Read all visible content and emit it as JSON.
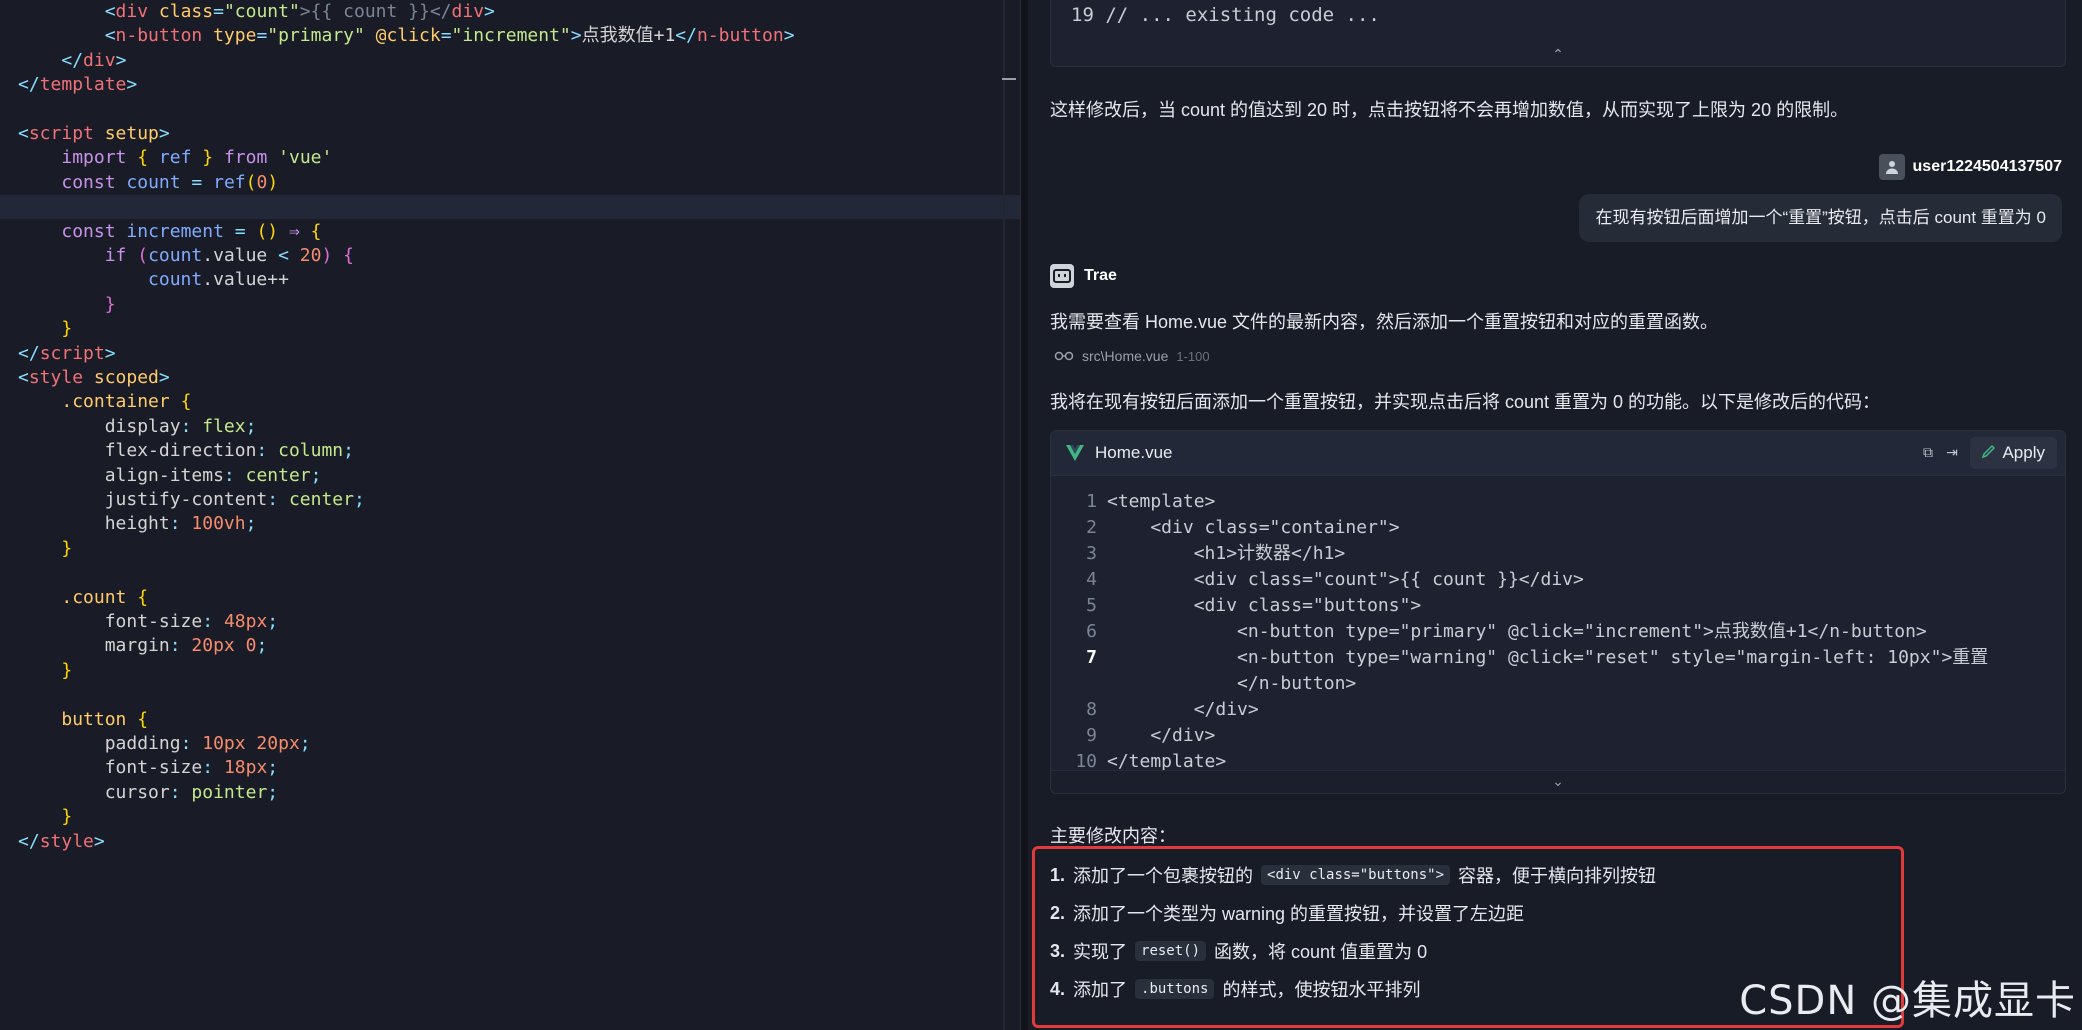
{
  "editor": {
    "lines": [
      [
        [
          "        ",
          "tok-text"
        ],
        [
          "<",
          "tok-punc"
        ],
        [
          "div ",
          "tok-tag"
        ],
        [
          "class",
          "tok-attr"
        ],
        [
          "=",
          "tok-punc"
        ],
        [
          "\"count\"",
          "tok-str"
        ],
        [
          ">{{ count }}</",
          "tok-cmt"
        ],
        [
          "div",
          "tok-tag"
        ],
        [
          ">",
          "tok-punc"
        ]
      ],
      [
        [
          "        ",
          "tok-text"
        ],
        [
          "<",
          "tok-punc"
        ],
        [
          "n-button ",
          "tok-tag"
        ],
        [
          "type",
          "tok-attr"
        ],
        [
          "=",
          "tok-punc"
        ],
        [
          "\"primary\" ",
          "tok-str"
        ],
        [
          "@click",
          "tok-attr"
        ],
        [
          "=",
          "tok-punc"
        ],
        [
          "\"increment\"",
          "tok-str"
        ],
        [
          ">",
          "tok-punc"
        ],
        [
          "点我数值+1",
          "tok-text"
        ],
        [
          "</",
          "tok-punc"
        ],
        [
          "n-button",
          "tok-tag"
        ],
        [
          ">",
          "tok-punc"
        ]
      ],
      [
        [
          "    ",
          "tok-text"
        ],
        [
          "</",
          "tok-punc"
        ],
        [
          "div",
          "tok-tag"
        ],
        [
          ">",
          "tok-punc"
        ]
      ],
      [
        [
          "</",
          "tok-punc"
        ],
        [
          "template",
          "tok-tag"
        ],
        [
          ">",
          "tok-punc"
        ]
      ],
      [
        [
          "",
          "tok-text"
        ]
      ],
      [
        [
          "<",
          "tok-punc"
        ],
        [
          "script ",
          "tok-tag"
        ],
        [
          "setup",
          "tok-attr"
        ],
        [
          ">",
          "tok-punc"
        ]
      ],
      [
        [
          "    ",
          "tok-text"
        ],
        [
          "import ",
          "tok-kw"
        ],
        [
          "{ ",
          "tok-brace"
        ],
        [
          "ref ",
          "tok-var"
        ],
        [
          "} ",
          "tok-brace"
        ],
        [
          "from ",
          "tok-kw"
        ],
        [
          "'vue'",
          "tok-str"
        ]
      ],
      [
        [
          "    ",
          "tok-text"
        ],
        [
          "const ",
          "tok-kw"
        ],
        [
          "count ",
          "tok-var"
        ],
        [
          "= ",
          "tok-punc"
        ],
        [
          "ref",
          "tok-var"
        ],
        [
          "(",
          "tok-brace"
        ],
        [
          "0",
          "tok-num"
        ],
        [
          ")",
          "tok-brace"
        ]
      ],
      [
        [
          "",
          "tok-text"
        ]
      ],
      [
        [
          "    ",
          "tok-text"
        ],
        [
          "const ",
          "tok-kw"
        ],
        [
          "increment ",
          "tok-var"
        ],
        [
          "= ",
          "tok-punc"
        ],
        [
          "() ",
          "tok-brace"
        ],
        [
          "⇒ ",
          "tok-kw"
        ],
        [
          "{",
          "tok-brace"
        ]
      ],
      [
        [
          "        ",
          "tok-text"
        ],
        [
          "if ",
          "tok-kw"
        ],
        [
          "(",
          "tok-brace2"
        ],
        [
          "count",
          "tok-var"
        ],
        [
          ".value ",
          "tok-prop"
        ],
        [
          "< ",
          "tok-punc"
        ],
        [
          "20",
          "tok-num"
        ],
        [
          ") {",
          "tok-brace2"
        ]
      ],
      [
        [
          "            ",
          "tok-text"
        ],
        [
          "count",
          "tok-var"
        ],
        [
          ".value++",
          "tok-prop"
        ]
      ],
      [
        [
          "        ",
          "tok-text"
        ],
        [
          "}",
          "tok-brace2"
        ]
      ],
      [
        [
          "    ",
          "tok-text"
        ],
        [
          "}",
          "tok-brace"
        ]
      ],
      [
        [
          "</",
          "tok-punc"
        ],
        [
          "script",
          "tok-tag"
        ],
        [
          ">",
          "tok-punc"
        ]
      ],
      [
        [
          "<",
          "tok-punc"
        ],
        [
          "style ",
          "tok-tag"
        ],
        [
          "scoped",
          "tok-attr"
        ],
        [
          ">",
          "tok-punc"
        ]
      ],
      [
        [
          "    ",
          "tok-text"
        ],
        [
          ".container ",
          "tok-attr"
        ],
        [
          "{",
          "tok-brace"
        ]
      ],
      [
        [
          "        ",
          "tok-text"
        ],
        [
          "display",
          "tok-prop"
        ],
        [
          ": ",
          "tok-punc"
        ],
        [
          "flex",
          "tok-val"
        ],
        [
          ";",
          "tok-punc"
        ]
      ],
      [
        [
          "        ",
          "tok-text"
        ],
        [
          "flex-direction",
          "tok-prop"
        ],
        [
          ": ",
          "tok-punc"
        ],
        [
          "column",
          "tok-val"
        ],
        [
          ";",
          "tok-punc"
        ]
      ],
      [
        [
          "        ",
          "tok-text"
        ],
        [
          "align-items",
          "tok-prop"
        ],
        [
          ": ",
          "tok-punc"
        ],
        [
          "center",
          "tok-val"
        ],
        [
          ";",
          "tok-punc"
        ]
      ],
      [
        [
          "        ",
          "tok-text"
        ],
        [
          "justify-content",
          "tok-prop"
        ],
        [
          ": ",
          "tok-punc"
        ],
        [
          "center",
          "tok-val"
        ],
        [
          ";",
          "tok-punc"
        ]
      ],
      [
        [
          "        ",
          "tok-text"
        ],
        [
          "height",
          "tok-prop"
        ],
        [
          ": ",
          "tok-punc"
        ],
        [
          "100vh",
          "tok-num"
        ],
        [
          ";",
          "tok-punc"
        ]
      ],
      [
        [
          "    ",
          "tok-text"
        ],
        [
          "}",
          "tok-brace"
        ]
      ],
      [
        [
          "",
          "tok-text"
        ]
      ],
      [
        [
          "    ",
          "tok-text"
        ],
        [
          ".count ",
          "tok-attr"
        ],
        [
          "{",
          "tok-brace"
        ]
      ],
      [
        [
          "        ",
          "tok-text"
        ],
        [
          "font-size",
          "tok-prop"
        ],
        [
          ": ",
          "tok-punc"
        ],
        [
          "48px",
          "tok-num"
        ],
        [
          ";",
          "tok-punc"
        ]
      ],
      [
        [
          "        ",
          "tok-text"
        ],
        [
          "margin",
          "tok-prop"
        ],
        [
          ": ",
          "tok-punc"
        ],
        [
          "20px 0",
          "tok-num"
        ],
        [
          ";",
          "tok-punc"
        ]
      ],
      [
        [
          "    ",
          "tok-text"
        ],
        [
          "}",
          "tok-brace"
        ]
      ],
      [
        [
          "",
          "tok-text"
        ]
      ],
      [
        [
          "    ",
          "tok-text"
        ],
        [
          "button ",
          "tok-attr"
        ],
        [
          "{",
          "tok-brace"
        ]
      ],
      [
        [
          "        ",
          "tok-text"
        ],
        [
          "padding",
          "tok-prop"
        ],
        [
          ": ",
          "tok-punc"
        ],
        [
          "10px 20px",
          "tok-num"
        ],
        [
          ";",
          "tok-punc"
        ]
      ],
      [
        [
          "        ",
          "tok-text"
        ],
        [
          "font-size",
          "tok-prop"
        ],
        [
          ": ",
          "tok-punc"
        ],
        [
          "18px",
          "tok-num"
        ],
        [
          ";",
          "tok-punc"
        ]
      ],
      [
        [
          "        ",
          "tok-text"
        ],
        [
          "cursor",
          "tok-prop"
        ],
        [
          ": ",
          "tok-punc"
        ],
        [
          "pointer",
          "tok-val"
        ],
        [
          ";",
          "tok-punc"
        ]
      ],
      [
        [
          "    ",
          "tok-text"
        ],
        [
          "}",
          "tok-brace"
        ]
      ],
      [
        [
          "</",
          "tok-punc"
        ],
        [
          "style",
          "tok-tag"
        ],
        [
          ">",
          "tok-punc"
        ]
      ]
    ]
  },
  "chat": {
    "top_code_line": "19 // ... existing code ...",
    "summary_text": "这样修改后，当 count 的值达到 20 时，点击按钮将不会再增加数值，从而实现了上限为 20 的限制。",
    "user_name": "user1224504137507",
    "user_message": "在现有按钮后面增加一个“重置”按钮，点击后 count 重置为 0",
    "bot_name": "Trae",
    "bot_intro": "我需要查看 Home.vue 文件的最新内容，然后添加一个重置按钮和对应的重置函数。",
    "file_ref": "src\\Home.vue",
    "file_range": "1-100",
    "bot_plan": "我将在现有按钮后面添加一个重置按钮，并实现点击后将 count 重置为 0 的功能。以下是修改后的代码：",
    "code_card": {
      "file_name": "Home.vue",
      "apply_label": "Apply",
      "lines": [
        {
          "num": "1",
          "text": "<template>",
          "bold": false
        },
        {
          "num": "2",
          "text": "    <div class=\"container\">",
          "bold": false
        },
        {
          "num": "3",
          "text": "        <h1>计数器</h1>",
          "bold": false
        },
        {
          "num": "4",
          "text": "        <div class=\"count\">{{ count }}</div>",
          "bold": false
        },
        {
          "num": "5",
          "text": "        <div class=\"buttons\">",
          "bold": false
        },
        {
          "num": "6",
          "text": "            <n-button type=\"primary\" @click=\"increment\">点我数值+1</n-button>",
          "bold": false
        },
        {
          "num": "7",
          "text": "            <n-button type=\"warning\" @click=\"reset\" style=\"margin-left: 10px\">重置",
          "bold": true
        },
        {
          "num": "",
          "text": "            </n-button>",
          "bold": false
        },
        {
          "num": "8",
          "text": "        </div>",
          "bold": false
        },
        {
          "num": "9",
          "text": "    </div>",
          "bold": false
        },
        {
          "num": "10",
          "text": "</template>",
          "bold": false
        }
      ]
    },
    "changes_title": "主要修改内容：",
    "changes": [
      {
        "idx": "1.",
        "before": "添加了一个包裹按钮的",
        "code": "<div class=\"buttons\">",
        "after": "容器，便于横向排列按钮"
      },
      {
        "idx": "2.",
        "before": "添加了一个类型为 warning 的重置按钮，并设置了左边距",
        "code": "",
        "after": ""
      },
      {
        "idx": "3.",
        "before": "实现了",
        "code": "reset()",
        "after": "函数，将 count 值重置为 0"
      },
      {
        "idx": "4.",
        "before": "添加了",
        "code": ".buttons",
        "after": "的样式，使按钮水平排列"
      }
    ],
    "watermark": "CSDN @集成显卡"
  },
  "colors": {
    "highlight_border": "#e03a3a",
    "accent_vue": "#41b883"
  }
}
